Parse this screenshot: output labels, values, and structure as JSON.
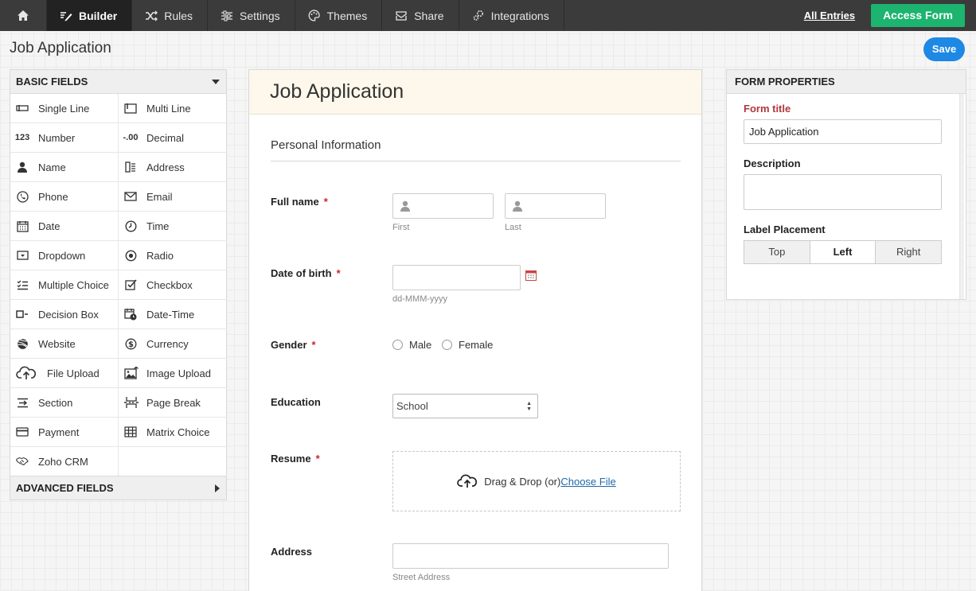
{
  "nav": {
    "items": [
      {
        "label": "Builder",
        "icon": "builder-icon"
      },
      {
        "label": "Rules",
        "icon": "shuffle-icon"
      },
      {
        "label": "Settings",
        "icon": "settings-icon"
      },
      {
        "label": "Themes",
        "icon": "palette-icon"
      },
      {
        "label": "Share",
        "icon": "share-icon"
      },
      {
        "label": "Integrations",
        "icon": "integrations-icon"
      }
    ],
    "all_entries": "All Entries",
    "access_form": "Access Form",
    "active_color": "#1cb46e"
  },
  "page_title": "Job Application",
  "save_label": "Save",
  "basic_fields": {
    "title": "BASIC FIELDS",
    "items": [
      {
        "label": "Single Line",
        "icon": "single-line-icon"
      },
      {
        "label": "Multi Line",
        "icon": "multi-line-icon"
      },
      {
        "label": "Number",
        "icon": "number-icon"
      },
      {
        "label": "Decimal",
        "icon": "decimal-icon"
      },
      {
        "label": "Name",
        "icon": "person-icon"
      },
      {
        "label": "Address",
        "icon": "address-icon"
      },
      {
        "label": "Phone",
        "icon": "phone-icon"
      },
      {
        "label": "Email",
        "icon": "email-icon"
      },
      {
        "label": "Date",
        "icon": "calendar-icon"
      },
      {
        "label": "Time",
        "icon": "clock-icon"
      },
      {
        "label": "Dropdown",
        "icon": "dropdown-icon"
      },
      {
        "label": "Radio",
        "icon": "radio-icon"
      },
      {
        "label": "Multiple Choice",
        "icon": "multiple-choice-icon"
      },
      {
        "label": "Checkbox",
        "icon": "checkbox-icon"
      },
      {
        "label": "Decision Box",
        "icon": "decision-box-icon"
      },
      {
        "label": "Date-Time",
        "icon": "date-time-icon"
      },
      {
        "label": "Website",
        "icon": "globe-icon"
      },
      {
        "label": "Currency",
        "icon": "currency-icon"
      },
      {
        "label": "File Upload",
        "icon": "cloud-upload-icon"
      },
      {
        "label": "Image Upload",
        "icon": "image-icon"
      },
      {
        "label": "Section",
        "icon": "section-icon"
      },
      {
        "label": "Page Break",
        "icon": "page-break-icon"
      },
      {
        "label": "Payment",
        "icon": "card-icon"
      },
      {
        "label": "Matrix Choice",
        "icon": "matrix-icon"
      },
      {
        "label": "Zoho CRM",
        "icon": "handshake-icon"
      }
    ]
  },
  "advanced_fields": "ADVANCED FIELDS",
  "form": {
    "title": "Job Application",
    "section": "Personal Information",
    "full_name": {
      "label": "Full name",
      "req": "*",
      "first": "First",
      "last": "Last"
    },
    "dob": {
      "label": "Date of birth",
      "req": "*",
      "hint": "dd-MMM-yyyy"
    },
    "gender": {
      "label": "Gender",
      "req": "*",
      "options": [
        "Male",
        "Female"
      ]
    },
    "education": {
      "label": "Education",
      "value": "School"
    },
    "resume": {
      "label": "Resume",
      "req": "*",
      "drop_text": "Drag & Drop (or)",
      "choose": " Choose File"
    },
    "address": {
      "label": "Address",
      "street": "Street Address"
    }
  },
  "props": {
    "title": "FORM PROPERTIES",
    "form_title_label": "Form title",
    "form_title_value": "Job Application",
    "description_label": "Description",
    "label_placement_label": "Label Placement",
    "placement_options": [
      "Top",
      "Left",
      "Right"
    ],
    "placement_selected": "Left"
  }
}
